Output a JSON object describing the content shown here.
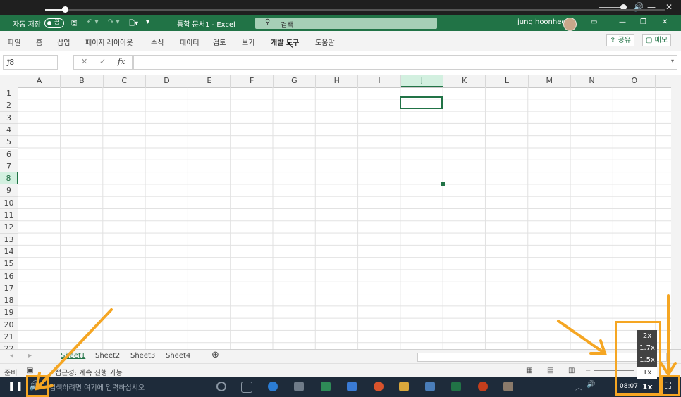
{
  "window": {
    "autosave_label": "자동 저장",
    "autosave_state": "끔",
    "doc_title": "통합 문서1  -  Excel",
    "search_placeholder": "검색",
    "user_name": "jung hoonhee"
  },
  "ribbon": {
    "tabs": [
      "파일",
      "홈",
      "삽입",
      "페이지 레이아웃",
      "수식",
      "데이터",
      "검토",
      "보기",
      "개발 도구",
      "도움말"
    ],
    "active_tab": "개발 도구",
    "share_label": "공유",
    "memo_label": "메모"
  },
  "formula_bar": {
    "name_box": "J8",
    "fx_label": "fx",
    "formula_value": ""
  },
  "grid": {
    "columns": [
      "A",
      "B",
      "C",
      "D",
      "E",
      "F",
      "G",
      "H",
      "I",
      "J",
      "K",
      "L",
      "M",
      "N",
      "O"
    ],
    "rows": [
      "1",
      "2",
      "3",
      "4",
      "5",
      "6",
      "7",
      "8",
      "9",
      "10",
      "11",
      "12",
      "13",
      "14",
      "15",
      "16",
      "17",
      "18",
      "19",
      "20",
      "21",
      "22"
    ],
    "selected_cell": "J8"
  },
  "sheets": {
    "tabs": [
      "Sheet1",
      "Sheet2",
      "Sheet3",
      "Sheet4"
    ],
    "active": "Sheet1"
  },
  "status": {
    "ready": "준비",
    "accessibility": "접근성: 계속 진행 가능"
  },
  "player": {
    "taskbar_search_text": "검색하려면 여기에 입력하십시오",
    "speed_options": [
      "2x",
      "1.7x",
      "1.5x",
      "1x"
    ],
    "current_speed": "1x",
    "time": "08:07",
    "rate_display": "1x"
  },
  "colors": {
    "excel_green": "#217346",
    "annotation_orange": "#f5a623"
  }
}
